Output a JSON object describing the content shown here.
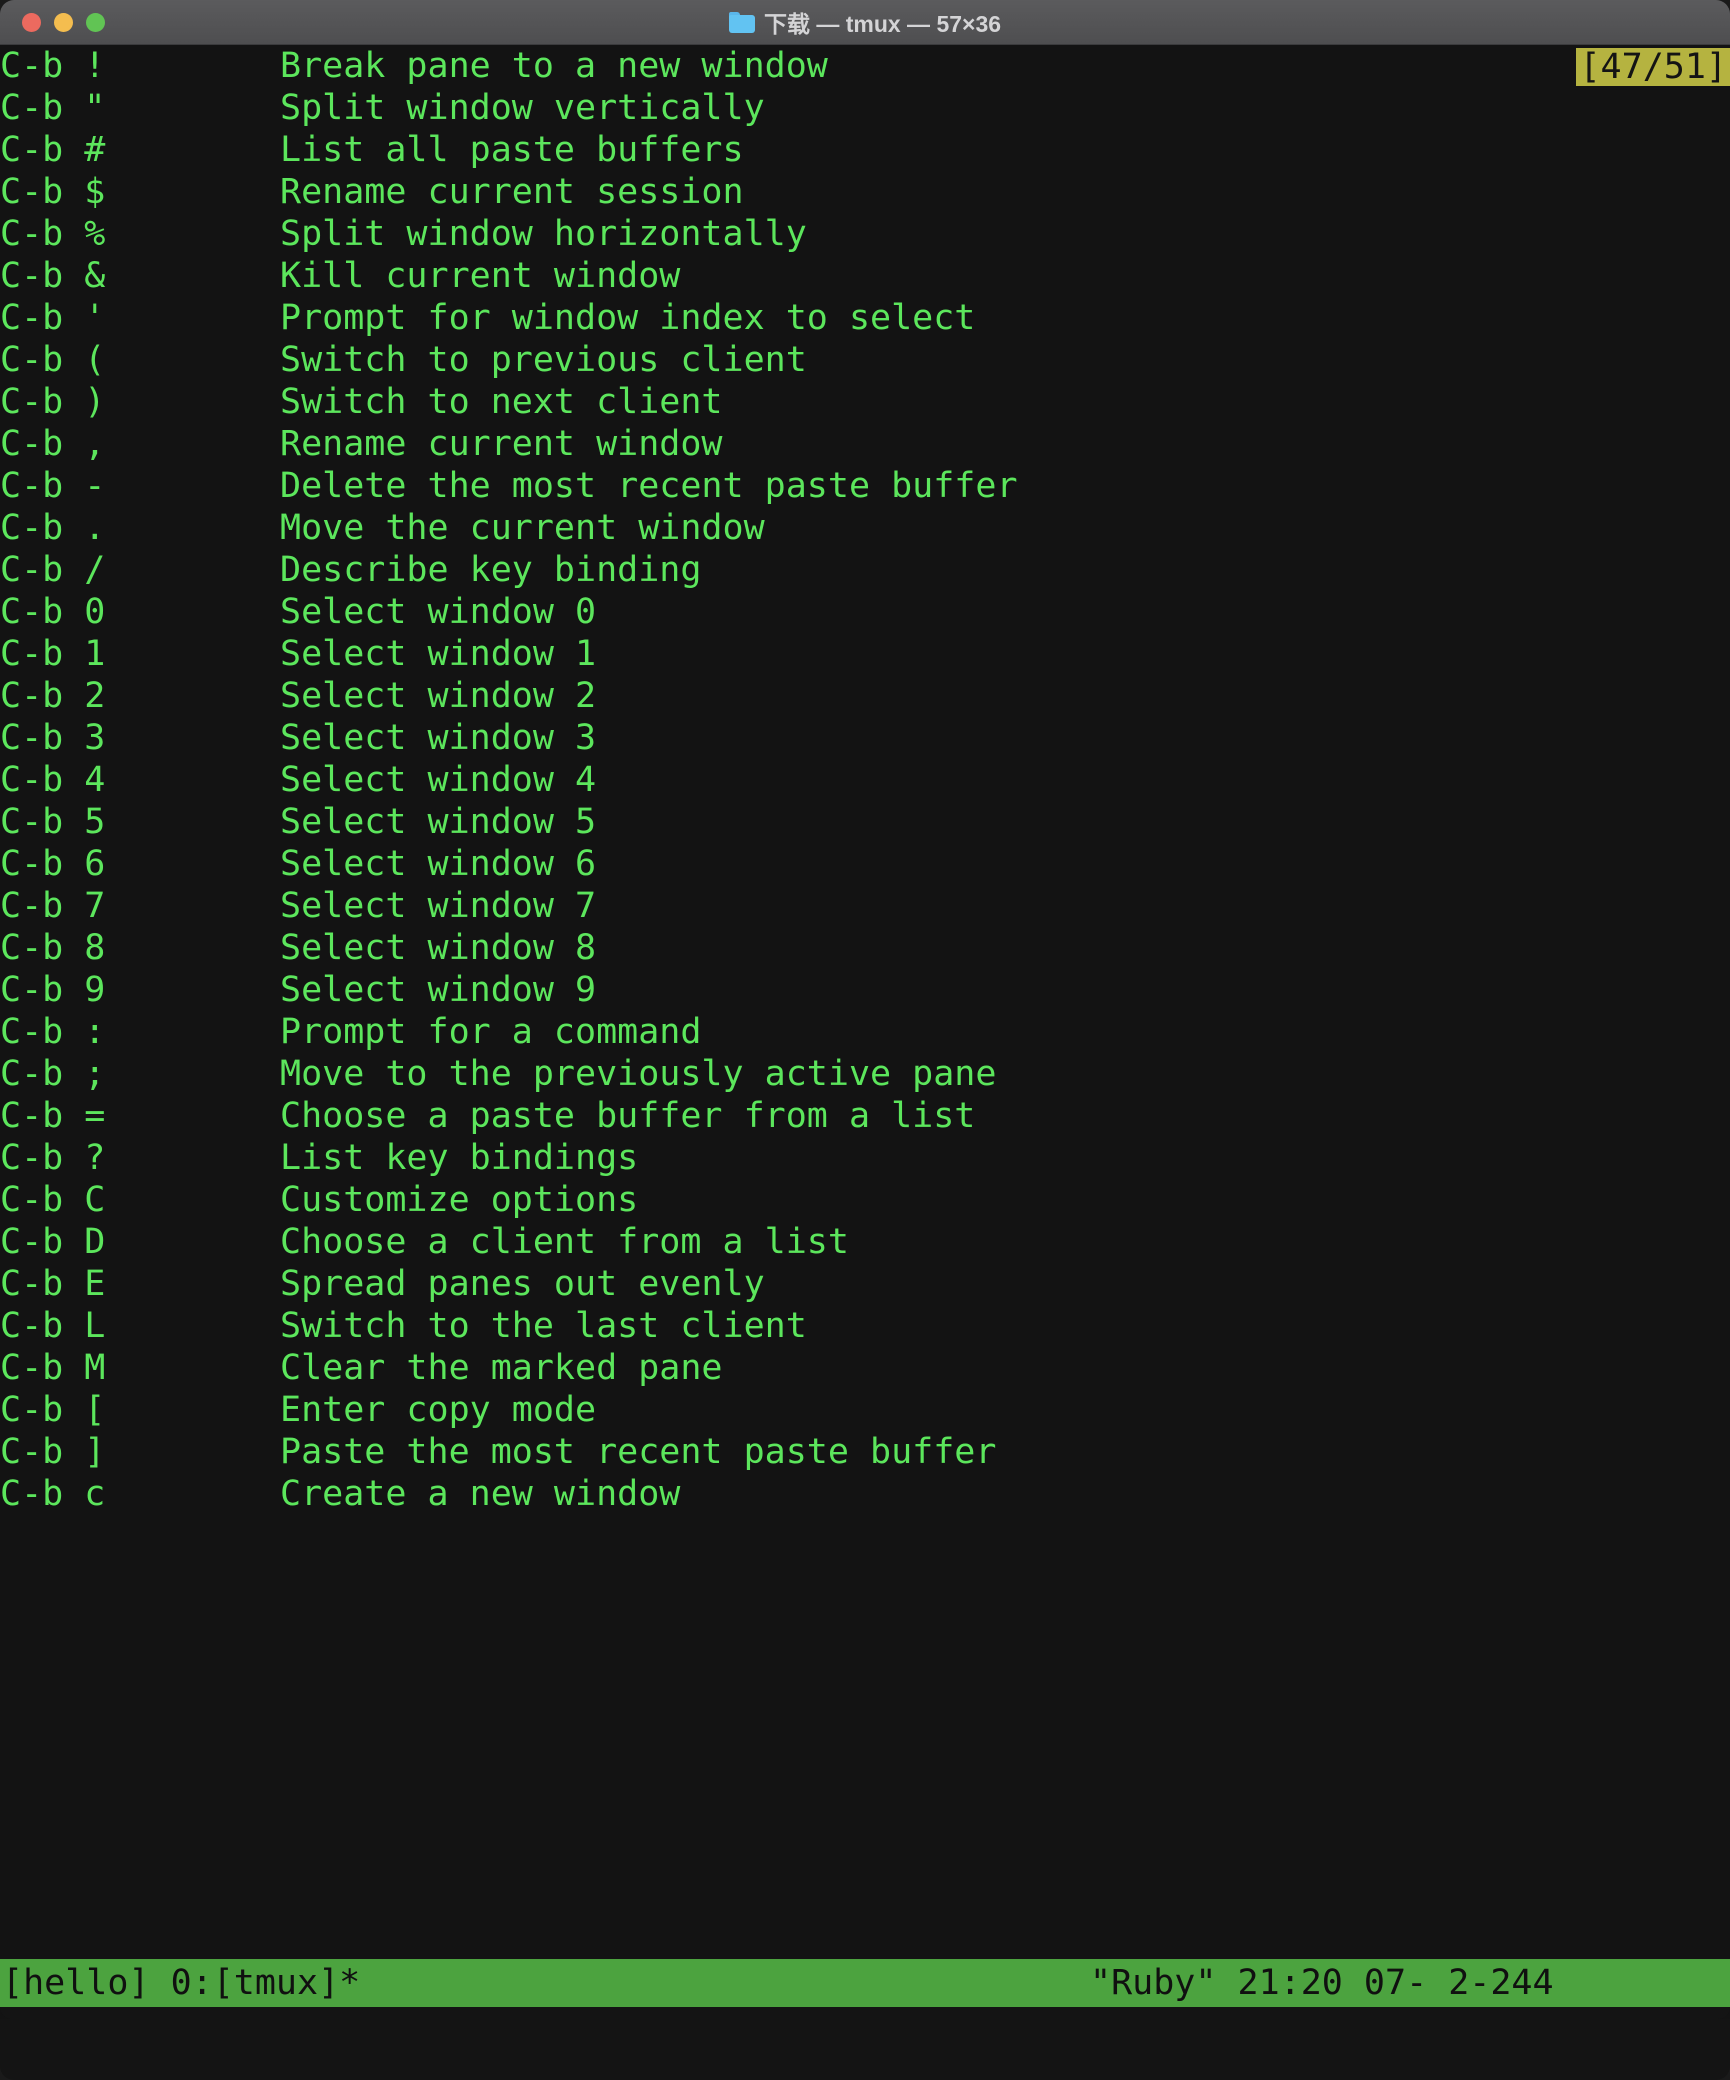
{
  "window": {
    "title": "下载 — tmux — 57×36",
    "folder_icon": "folder-icon",
    "traffic_lights": {
      "close": "close-button",
      "minimize": "minimize-button",
      "zoom": "zoom-button"
    },
    "colors": {
      "titlebar": "#4e4e50",
      "terminal_bg": "#131313",
      "text_green": "#5ce65c",
      "status_bg": "#4ca33f",
      "indicator_bg": "#b5b340"
    }
  },
  "terminal": {
    "mode_indicator": "[47/51]",
    "rows": [
      {
        "key": "C-b !",
        "desc": "Break pane to a new window"
      },
      {
        "key": "C-b \"",
        "desc": "Split window vertically"
      },
      {
        "key": "C-b #",
        "desc": "List all paste buffers"
      },
      {
        "key": "C-b $",
        "desc": "Rename current session"
      },
      {
        "key": "C-b %",
        "desc": "Split window horizontally"
      },
      {
        "key": "C-b &",
        "desc": "Kill current window"
      },
      {
        "key": "C-b '",
        "desc": "Prompt for window index to select"
      },
      {
        "key": "C-b (",
        "desc": "Switch to previous client"
      },
      {
        "key": "C-b )",
        "desc": "Switch to next client"
      },
      {
        "key": "C-b ,",
        "desc": "Rename current window"
      },
      {
        "key": "C-b -",
        "desc": "Delete the most recent paste buffer"
      },
      {
        "key": "C-b .",
        "desc": "Move the current window"
      },
      {
        "key": "C-b /",
        "desc": "Describe key binding"
      },
      {
        "key": "C-b 0",
        "desc": "Select window 0"
      },
      {
        "key": "C-b 1",
        "desc": "Select window 1"
      },
      {
        "key": "C-b 2",
        "desc": "Select window 2"
      },
      {
        "key": "C-b 3",
        "desc": "Select window 3"
      },
      {
        "key": "C-b 4",
        "desc": "Select window 4"
      },
      {
        "key": "C-b 5",
        "desc": "Select window 5"
      },
      {
        "key": "C-b 6",
        "desc": "Select window 6"
      },
      {
        "key": "C-b 7",
        "desc": "Select window 7"
      },
      {
        "key": "C-b 8",
        "desc": "Select window 8"
      },
      {
        "key": "C-b 9",
        "desc": "Select window 9"
      },
      {
        "key": "C-b :",
        "desc": "Prompt for a command"
      },
      {
        "key": "C-b ;",
        "desc": "Move to the previously active pane"
      },
      {
        "key": "C-b =",
        "desc": "Choose a paste buffer from a list"
      },
      {
        "key": "C-b ?",
        "desc": "List key bindings"
      },
      {
        "key": "C-b C",
        "desc": "Customize options"
      },
      {
        "key": "C-b D",
        "desc": "Choose a client from a list"
      },
      {
        "key": "C-b E",
        "desc": "Spread panes out evenly"
      },
      {
        "key": "C-b L",
        "desc": "Switch to the last client"
      },
      {
        "key": "C-b M",
        "desc": "Clear the marked pane"
      },
      {
        "key": "C-b [",
        "desc": "Enter copy mode"
      },
      {
        "key": "C-b ]",
        "desc": "Paste the most recent paste buffer"
      },
      {
        "key": "C-b c",
        "desc": "Create a new window"
      }
    ]
  },
  "status_bar": {
    "left": "[hello] 0:[tmux]*",
    "right": "\"Ruby\" 21:20 07- 2-244"
  }
}
